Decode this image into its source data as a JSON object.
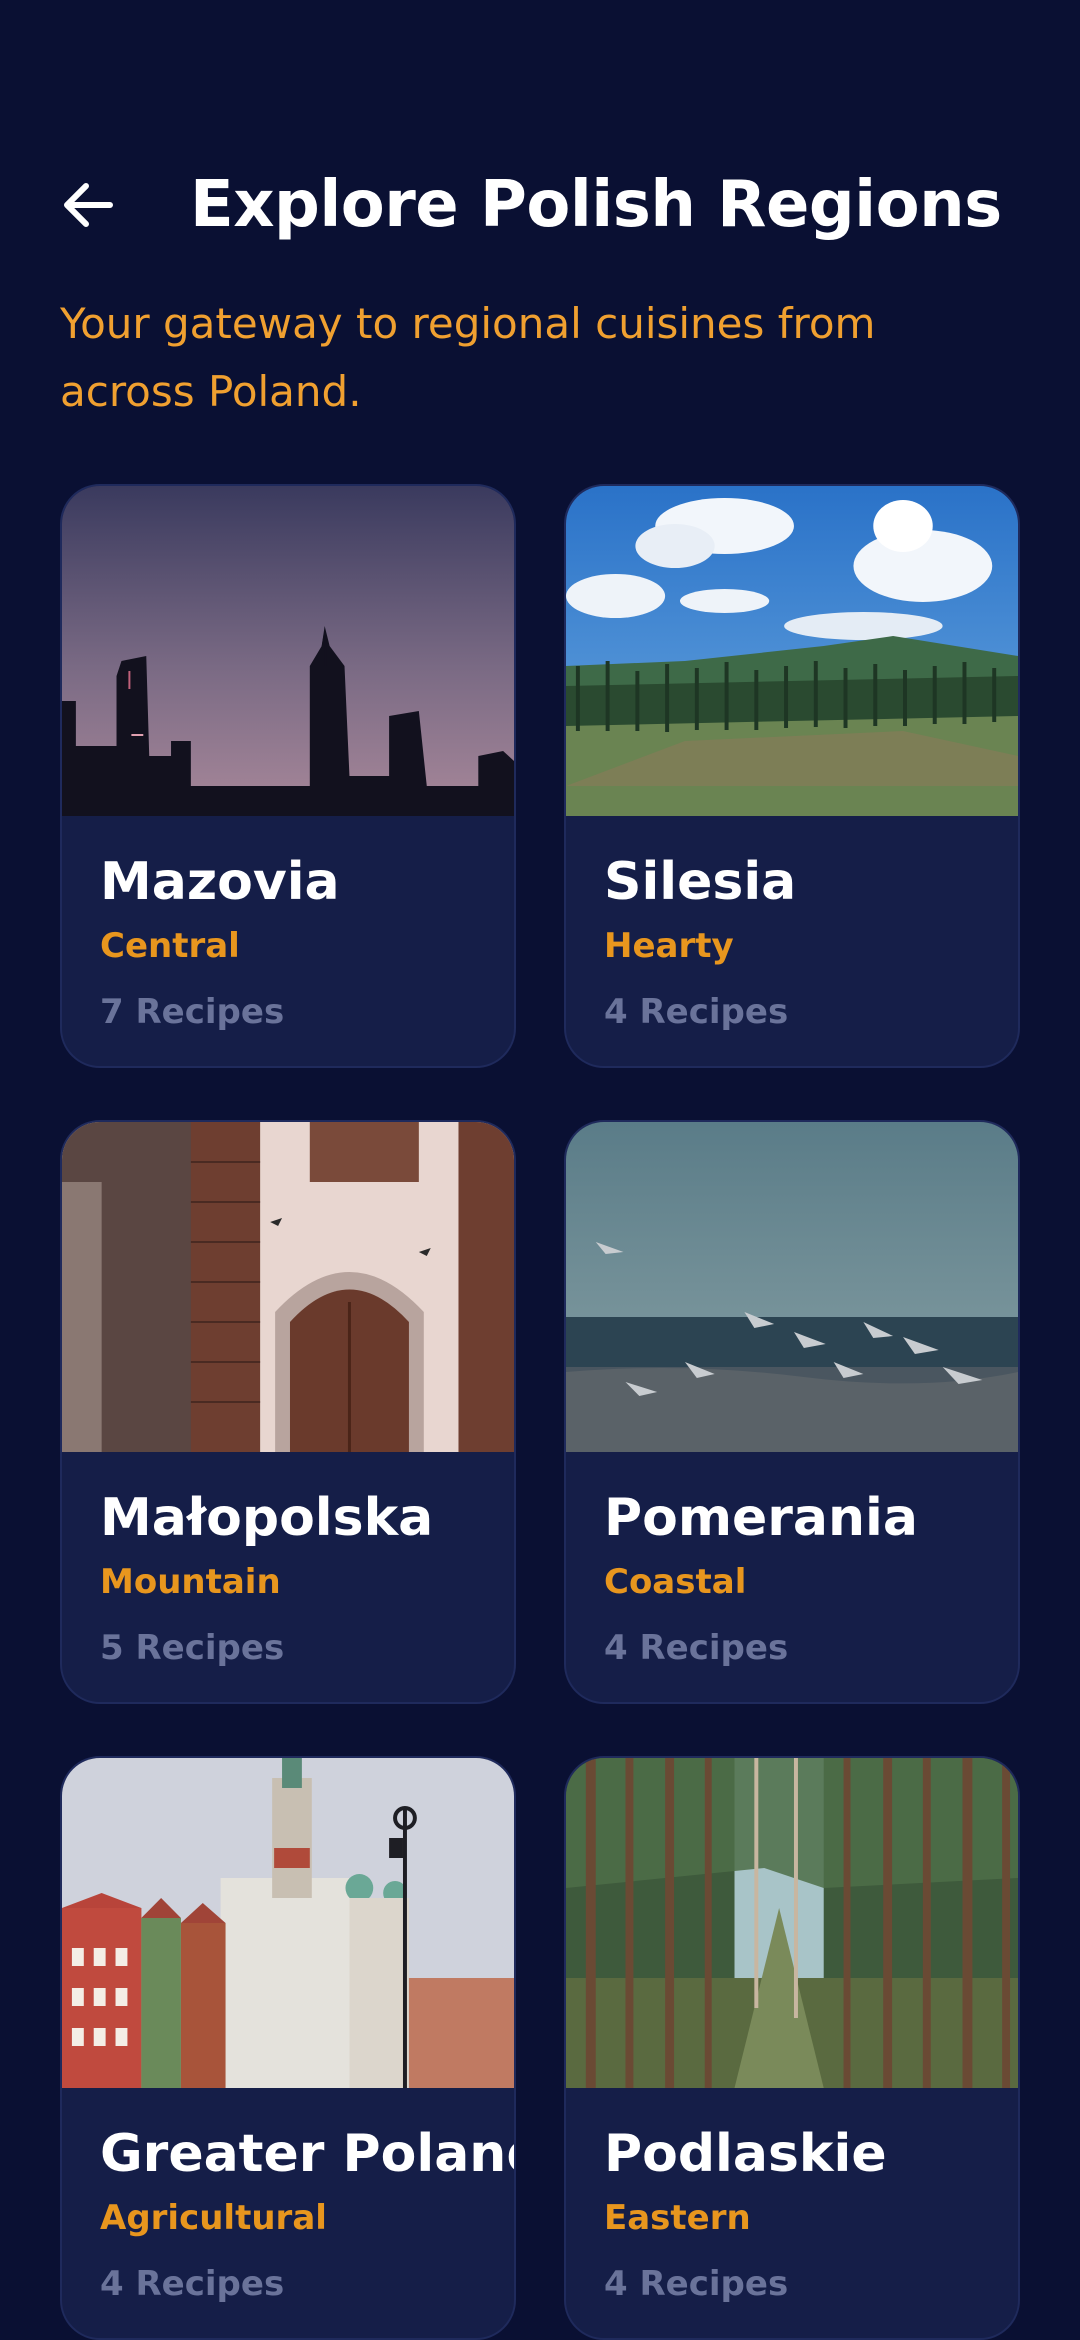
{
  "header": {
    "back_icon": "arrow-left-icon",
    "title": "Explore Polish Regions"
  },
  "subtitle": "Your gateway to regional cuisines from across Poland.",
  "colors": {
    "background": "#0a1033",
    "card": "#151e48",
    "accent": "#f0a030",
    "muted": "#6a739a"
  },
  "regions": [
    {
      "name": "Mazovia",
      "tag": "Central",
      "recipes": "7 Recipes",
      "image": "warsaw-skyline-dusk"
    },
    {
      "name": "Silesia",
      "tag": "Hearty",
      "recipes": "4 Recipes",
      "image": "forest-hills-blue-sky"
    },
    {
      "name": "Małopolska",
      "tag": "Mountain",
      "recipes": "5 Recipes",
      "image": "brick-church-doorway"
    },
    {
      "name": "Pomerania",
      "tag": "Coastal",
      "recipes": "4 Recipes",
      "image": "seagulls-baltic-sea"
    },
    {
      "name": "Greater Poland",
      "tag": "Agricultural",
      "recipes": "4 Recipes",
      "image": "poznan-old-town-hall"
    },
    {
      "name": "Podlaskie",
      "tag": "Eastern",
      "recipes": "4 Recipes",
      "image": "pine-forest-path"
    }
  ]
}
